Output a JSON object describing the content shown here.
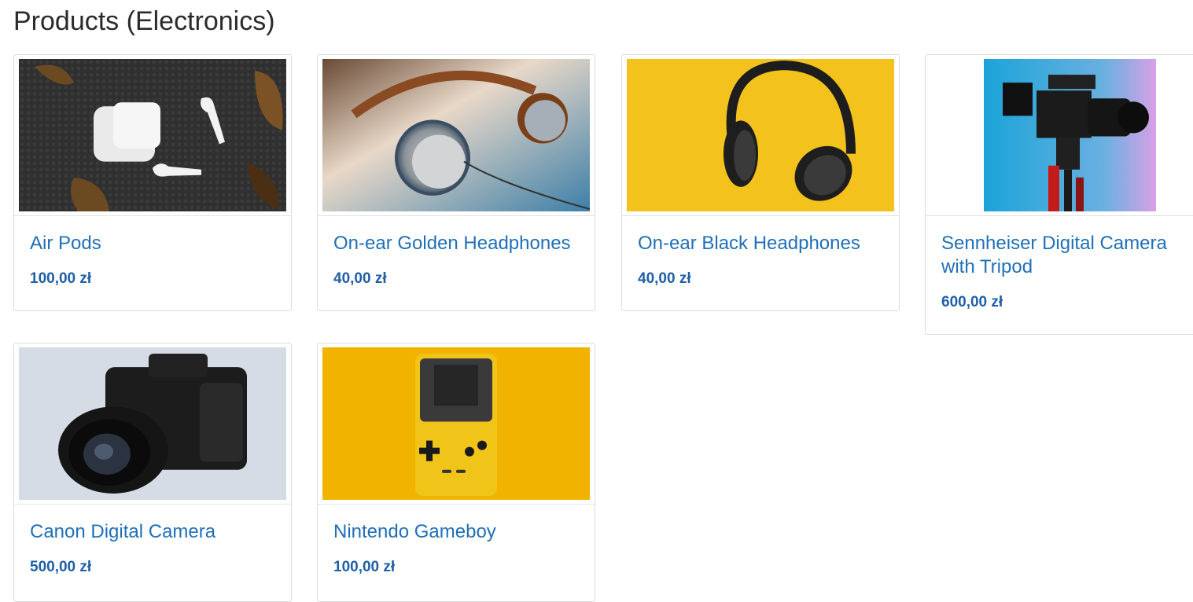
{
  "page": {
    "title": "Products (Electronics)"
  },
  "products": [
    {
      "name": "Air Pods",
      "price": "100,00 zł",
      "image": "airpods-image"
    },
    {
      "name": "On-ear Golden Headphones",
      "price": "40,00 zł",
      "image": "golden-headphones-image"
    },
    {
      "name": "On-ear Black Headphones",
      "price": "40,00 zł",
      "image": "black-headphones-image"
    },
    {
      "name": "Sennheiser Digital Camera with Tripod",
      "price": "600,00 zł",
      "image": "camera-tripod-image"
    },
    {
      "name": "Canon Digital Camera",
      "price": "500,00 zł",
      "image": "canon-camera-image"
    },
    {
      "name": "Nintendo Gameboy",
      "price": "100,00 zł",
      "image": "gameboy-image"
    }
  ],
  "colors": {
    "link": "#1f6fb8",
    "price": "#1f5fa8",
    "card_border": "#dcdcdc"
  }
}
